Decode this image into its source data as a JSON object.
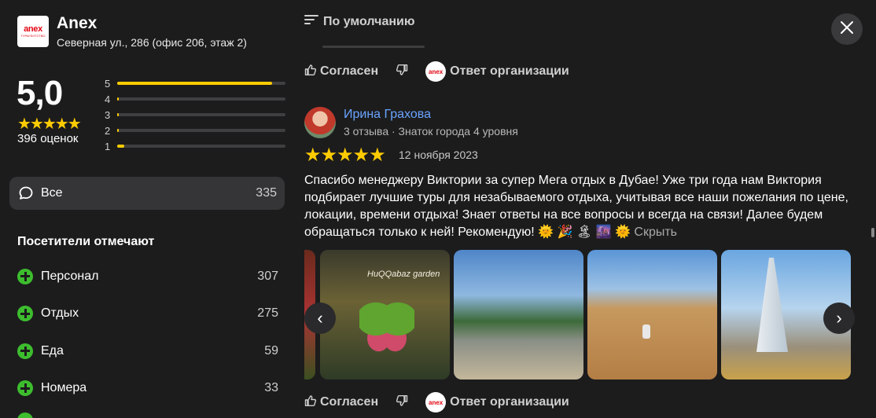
{
  "org": {
    "logo_text": "anex",
    "logo_subtext": "ТУРАГЕНТСТВО",
    "name": "Anex",
    "address": "Северная ул., 286 (офис 206, этаж 2)"
  },
  "rating": {
    "value": "5,0",
    "stars": "★★★★★",
    "count_label": "396 оценок",
    "bars": [
      {
        "label": "5",
        "fraction": 0.92
      },
      {
        "label": "4",
        "fraction": 0.01
      },
      {
        "label": "3",
        "fraction": 0.0
      },
      {
        "label": "2",
        "fraction": 0.0
      },
      {
        "label": "1",
        "fraction": 0.04
      }
    ]
  },
  "filters": {
    "all_label": "Все",
    "all_count": "335"
  },
  "visitors": {
    "title": "Посетители отмечают",
    "tags": [
      {
        "label": "Персонал",
        "count": "307"
      },
      {
        "label": "Отдых",
        "count": "275"
      },
      {
        "label": "Еда",
        "count": "59"
      },
      {
        "label": "Номера",
        "count": "33"
      }
    ]
  },
  "sort": {
    "label": "По умолчанию"
  },
  "actions": {
    "agree_label": "Согласен",
    "reply_label": "Ответ организации",
    "reply_logo": "anex"
  },
  "review": {
    "author": "Ирина Грахова",
    "meta": "3 отзыва · Знаток города 4 уровня",
    "stars": "★★★★★",
    "date": "12 ноября 2023",
    "text": "Спасибо менеджеру Виктории за супер Мега отдых в Дубае! Уже три года нам Виктория подбирает лучшие туры для незабываемого отдыха, учитывая все наши пожелания по цене, локации, времени отдыха! Знает ответы на все вопросы и всегда на связи! Далее будем обращаться только к ней! Рекомендую! 🌞 🎉 🏝 🌆 🌞",
    "hide_label": "Скрыть",
    "photo_sign": "HuQQabaz garden"
  },
  "nav": {
    "prev": "‹",
    "next": "›"
  }
}
